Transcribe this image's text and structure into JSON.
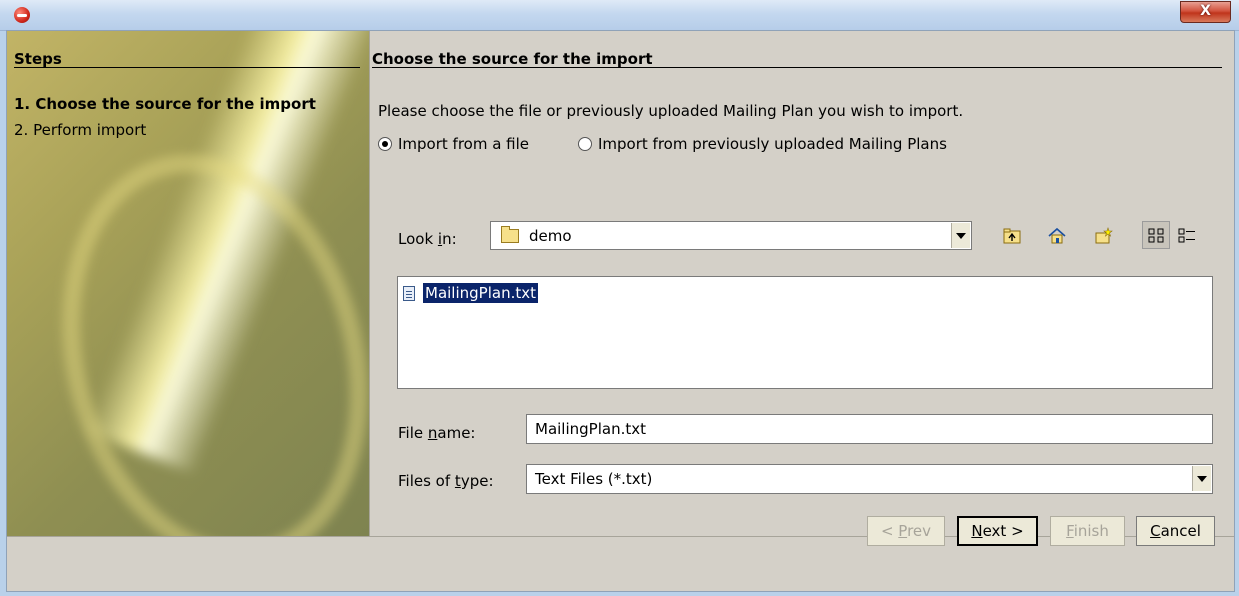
{
  "window": {
    "close_label": "X"
  },
  "steps": {
    "title": "Steps",
    "items": [
      {
        "label": "1. Choose the source for the import"
      },
      {
        "label": "2. Perform import"
      }
    ]
  },
  "content": {
    "title": "Choose the source for the import",
    "instruction": "Please choose the file or previously uploaded Mailing Plan you wish to import.",
    "radios": [
      {
        "label": "Import from a file",
        "checked": true
      },
      {
        "label": "Import from previously uploaded Mailing Plans",
        "checked": false
      }
    ]
  },
  "chooser": {
    "look_in_label_a": "Look ",
    "look_in_label_u": "i",
    "look_in_label_b": "n:",
    "look_in_value": "demo",
    "files": [
      {
        "name": "MailingPlan.txt"
      }
    ],
    "file_name_label_a": "File ",
    "file_name_label_u": "n",
    "file_name_label_b": "ame:",
    "file_name_value": "MailingPlan.txt",
    "files_type_label_a": "Files of ",
    "files_type_label_u": "t",
    "files_type_label_b": "ype:",
    "files_type_value": "Text Files (*.txt)",
    "tools": [
      {
        "icon": "folder-up-icon"
      },
      {
        "icon": "home-icon"
      },
      {
        "icon": "new-folder-icon"
      },
      {
        "icon": "list-view-icon"
      },
      {
        "icon": "details-view-icon"
      }
    ]
  },
  "buttons": {
    "prev_a": "< ",
    "prev_u": "P",
    "prev_b": "rev",
    "next_u": "N",
    "next_b": "ext >",
    "finish_u": "F",
    "finish_b": "inish",
    "cancel_u": "C",
    "cancel_b": "ancel"
  }
}
